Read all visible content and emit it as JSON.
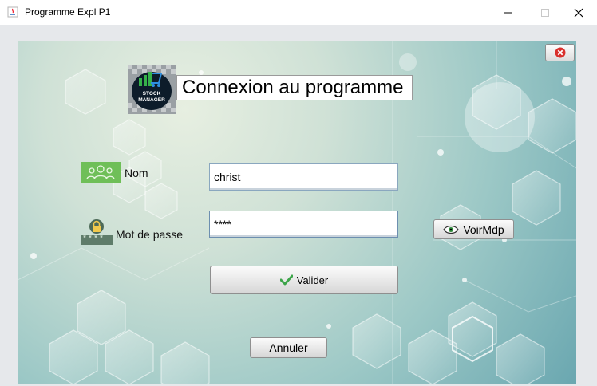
{
  "window": {
    "title": "Programme Expl P1",
    "controls": [
      "minimize-icon",
      "maximize-icon",
      "close-icon"
    ]
  },
  "header": {
    "logo_text_1": "STOCK",
    "logo_text_2": "MANAGER",
    "title": "Connexion au programme"
  },
  "form": {
    "nom_label": "Nom",
    "nom_value": "christ",
    "password_label": "Mot de passe",
    "password_value": "****",
    "password_icon_text": "****",
    "show_password_label": "VoirMdp",
    "submit_label": "Valider",
    "cancel_label": "Annuler"
  },
  "colors": {
    "accent_green": "#3da54a",
    "close_red": "#d9302c",
    "field_border": "#8aa7bf"
  }
}
